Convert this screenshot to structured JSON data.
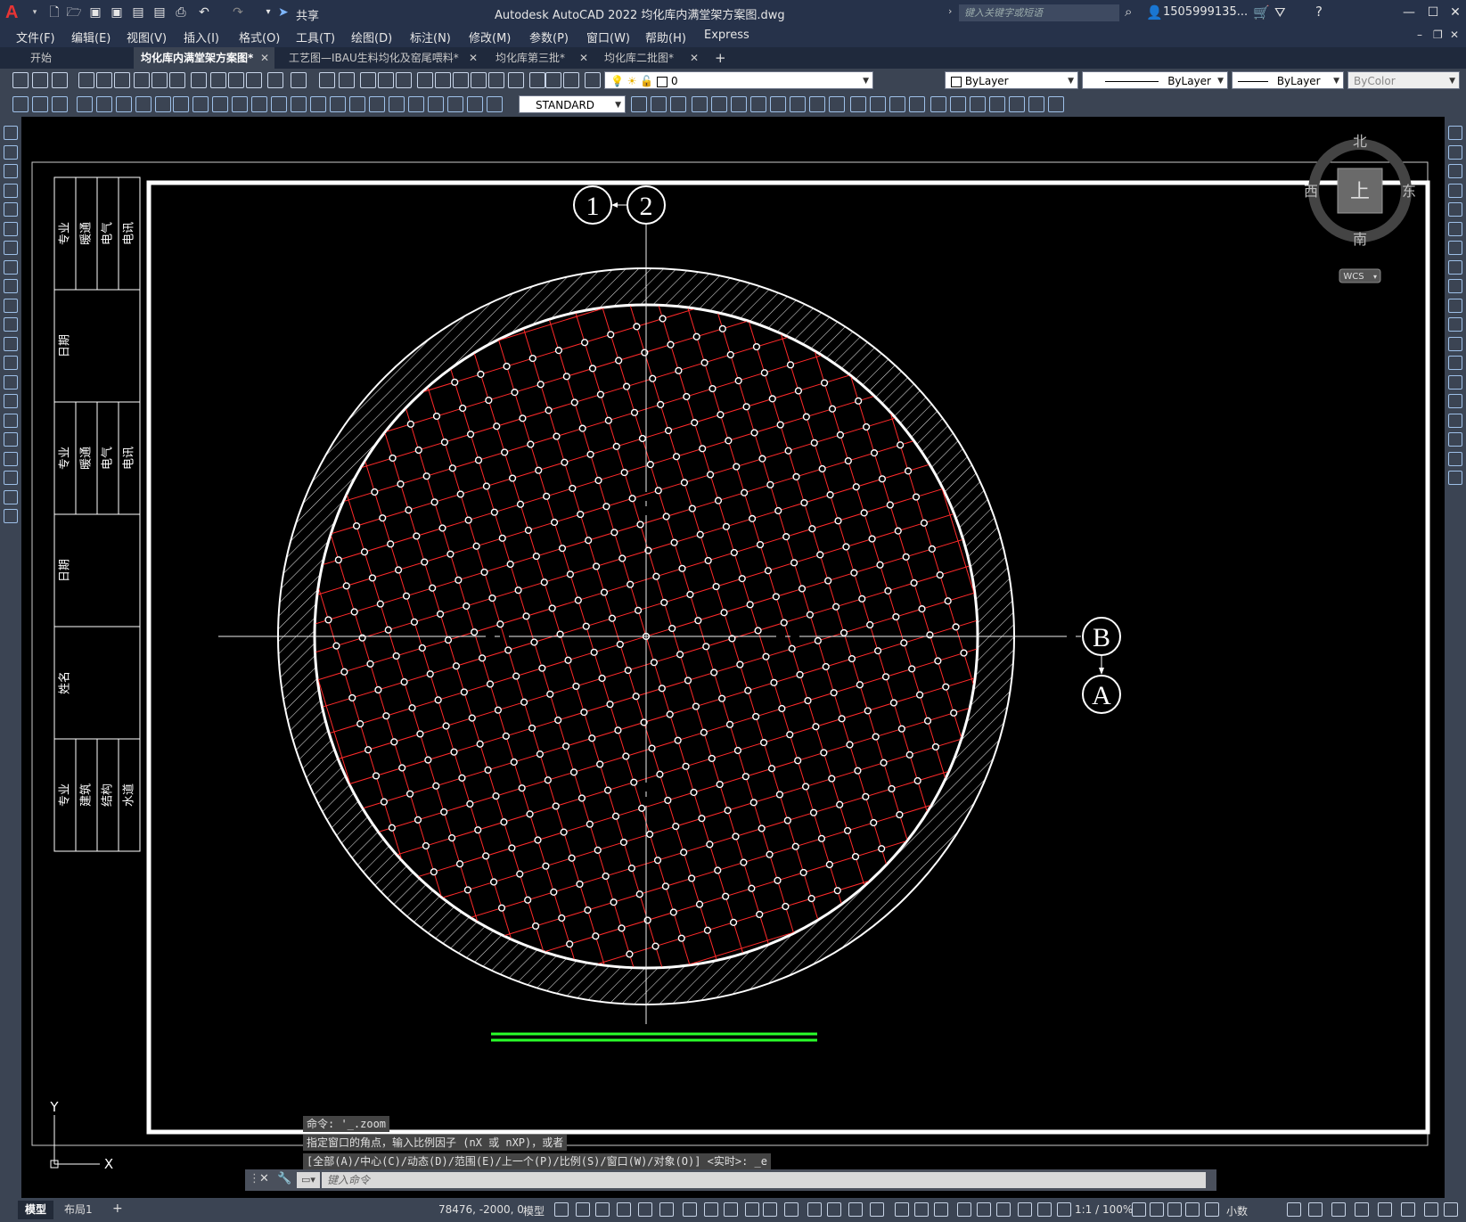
{
  "app": {
    "title": "Autodesk AutoCAD 2022    均化库内满堂架方案图.dwg",
    "search_placeholder": "键入关键字或短语",
    "user": "1505999135...",
    "share_label": "共享"
  },
  "menu": [
    "文件(F)",
    "编辑(E)",
    "视图(V)",
    "插入(I)",
    "格式(O)",
    "工具(T)",
    "绘图(D)",
    "标注(N)",
    "修改(M)",
    "参数(P)",
    "窗口(W)",
    "帮助(H)",
    "Express"
  ],
  "tabs": [
    {
      "label": "开始"
    },
    {
      "label": "均化库内满堂架方案图*",
      "active": true
    },
    {
      "label": "工艺图—IBAU生料均化及窑尾喂料*"
    },
    {
      "label": "均化库第三批*"
    },
    {
      "label": "均化库二批图*"
    }
  ],
  "toolbar": {
    "layer": "0",
    "color": "ByLayer",
    "linetype": "ByLayer",
    "lineweight": "ByLayer",
    "plotstyle": "ByColor",
    "textstyle": "STANDARD"
  },
  "viewcube": {
    "north": "北",
    "south": "南",
    "east": "东",
    "west": "西",
    "top": "上",
    "wcs": "WCS"
  },
  "drawing": {
    "grid_labels": {
      "a": "1",
      "b": "2",
      "c": "B",
      "d": "A"
    },
    "ucs": {
      "x": "X",
      "y": "Y"
    },
    "title_block": [
      [
        "专业",
        "暖通",
        "电气",
        "电讯"
      ],
      [
        "日期"
      ],
      [
        "专业",
        "暖通",
        "电气",
        "电讯"
      ],
      [
        "日期"
      ],
      [
        "姓名"
      ],
      [
        "专业",
        "建筑",
        "结构",
        "水道"
      ]
    ],
    "colors": {
      "frame": "#ffffff",
      "grid": "#ff2a2a",
      "node": "#ffffff",
      "scale": "#2aff2a"
    }
  },
  "command": {
    "history": [
      "命令: '_.zoom",
      "指定窗口的角点，输入比例因子 (nX 或 nXP)，或者",
      "[全部(A)/中心(C)/动态(D)/范围(E)/上一个(P)/比例(S)/窗口(W)/对象(O)] <实时>: _e"
    ],
    "placeholder": "键入命令"
  },
  "status": {
    "tabs": [
      {
        "label": "模型",
        "active": true
      },
      {
        "label": "布局1"
      }
    ],
    "coords": "78476, -2000, 0",
    "mode": "模型",
    "scale": "1:1 / 100%",
    "units": "小数"
  }
}
